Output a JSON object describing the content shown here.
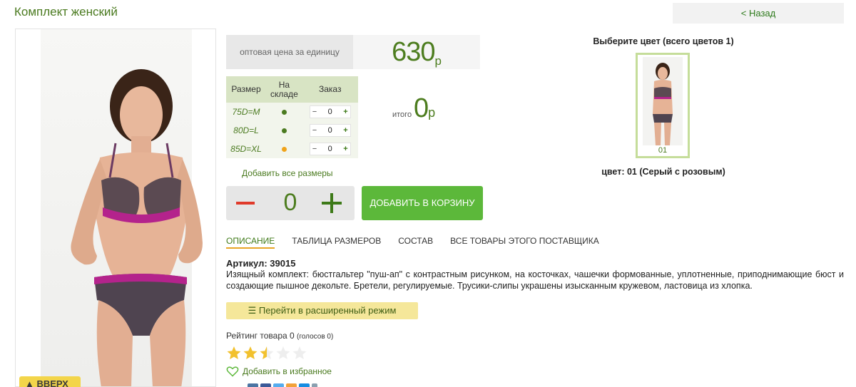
{
  "page": {
    "title": "Комплект женский",
    "back_label": "< Назад"
  },
  "photo": {
    "top_button_label": "ВВЕРХ"
  },
  "price": {
    "label": "оптовая цена за единицу",
    "value": "630",
    "currency": "р"
  },
  "sizes": {
    "headers": [
      "Размер",
      "На складе",
      "Заказ"
    ],
    "rows": [
      {
        "size": "75D=M",
        "stock_color": "#4a7a1f",
        "qty": "0"
      },
      {
        "size": "80D=L",
        "stock_color": "#4a7a1f",
        "qty": "0"
      },
      {
        "size": "85D=XL",
        "stock_color": "#f0a31a",
        "qty": "0"
      }
    ],
    "minus": "−",
    "plus": "+"
  },
  "total": {
    "label": "итого",
    "value": "0",
    "currency": "р"
  },
  "add_all_sizes": "Добавить все размеры",
  "quantity": {
    "value": "0"
  },
  "add_to_cart": "ДОБАВИТЬ В КОРЗИНУ",
  "tabs": [
    "ОПИСАНИЕ",
    "ТАБЛИЦА РАЗМЕРОВ",
    "СОСТАВ",
    "ВСЕ ТОВАРЫ ЭТОГО ПОСТАВЩИКА"
  ],
  "description": {
    "article": "Артикул: 39015",
    "text": "Изящный комплект: бюстгальтер \"пуш-ап\" с контрастным рисунком, на косточках, чашечки формованные, уплотненные, приподнимающие бюст и создающие пышное декольте. Бретели, регулируемые. Трусики-слипы украшены изысканным кружевом, ластовица из хлопка."
  },
  "advanced_mode": "Перейти в расширенный режим",
  "rating": {
    "label": "Рейтинг товара 0",
    "votes": "(голосов 0)",
    "stars_filled": 2.5,
    "stars_total": 5
  },
  "favorite": "Добавить в избранное",
  "colors": {
    "title": "Выберите цвет (всего цветов 1)",
    "swatch_number": "01",
    "selected": "цвет: 01 (Серый с розовым)"
  },
  "brand_colors": {
    "green": "#4d7d1f",
    "button_green": "#5cb83a",
    "star": "#f2c12e"
  }
}
